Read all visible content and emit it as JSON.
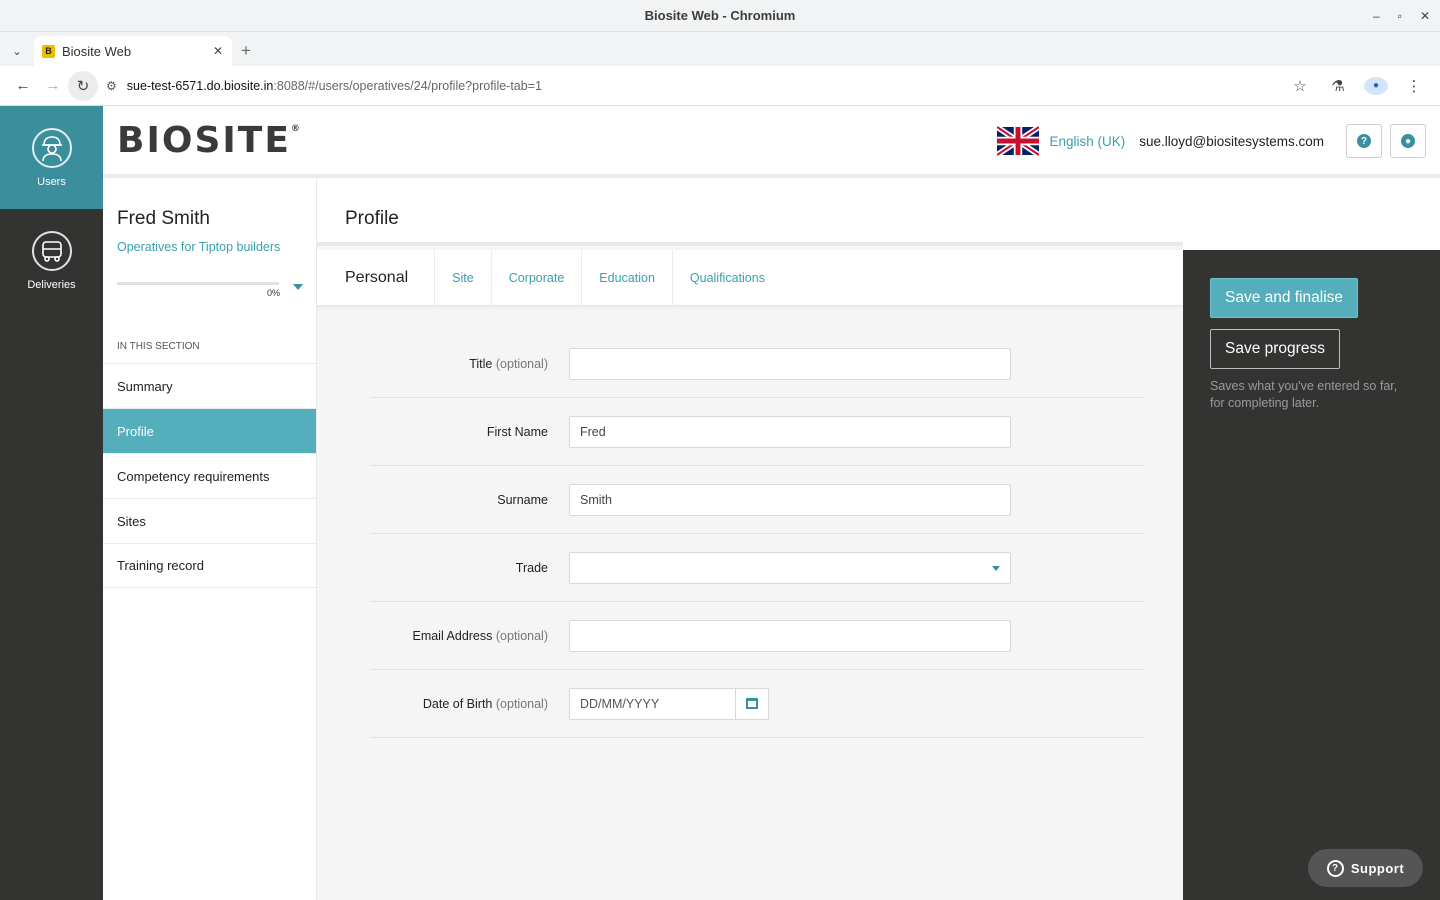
{
  "browser": {
    "window_title": "Biosite Web - Chromium",
    "tab_title": "Biosite Web",
    "favicon_letter": "B",
    "url_host": "sue-test-6571.do.biosite.in",
    "url_path": ":8088/#/users/operatives/24/profile?profile-tab=1"
  },
  "leftnav": {
    "items": [
      {
        "label": "Users",
        "icon": "worker-icon"
      },
      {
        "label": "Deliveries",
        "icon": "truck-icon"
      }
    ]
  },
  "header": {
    "logo": "BIOSITE",
    "logo_mark": "®",
    "language": "English (UK)",
    "user_email": "sue.lloyd@biositesystems.com",
    "help_icon": "question-icon",
    "account_icon": "user-circle-icon"
  },
  "person": {
    "name": "Fred Smith",
    "subtitle": "Operatives for Tiptop builders",
    "progress_percent": 0,
    "progress_label": "0%"
  },
  "section": {
    "label": "IN THIS SECTION",
    "items": [
      "Summary",
      "Profile",
      "Competency requirements",
      "Sites",
      "Training record"
    ],
    "active_index": 1
  },
  "page": {
    "title": "Profile",
    "tabs": [
      "Personal",
      "Site",
      "Corporate",
      "Education",
      "Qualifications"
    ],
    "active_tab": 0
  },
  "form": {
    "title_label": "Title",
    "first_name_label": "First Name",
    "first_name_value": "Fred",
    "surname_label": "Surname",
    "surname_value": "Smith",
    "trade_label": "Trade",
    "trade_value": "",
    "email_label": "Email Address",
    "dob_label": "Date of Birth",
    "dob_placeholder": "DD/MM/YYYY",
    "optional": "(optional)"
  },
  "actions": {
    "save_finalise": "Save and finalise",
    "save_progress": "Save progress",
    "note": "Saves what you've entered so far, for completing later."
  },
  "support": {
    "label": "Support"
  },
  "colors": {
    "accent": "#54aebb",
    "dark_panel": "#333332"
  }
}
